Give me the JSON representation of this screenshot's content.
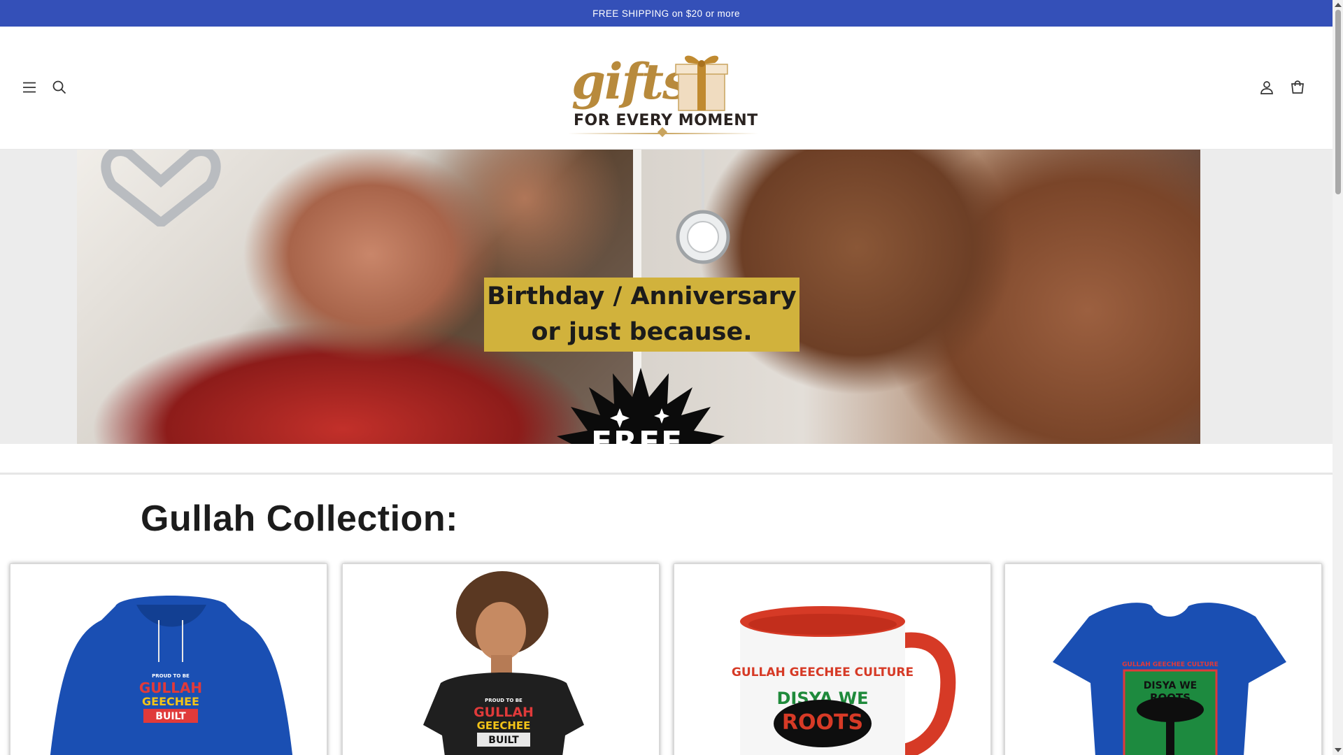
{
  "announcement": {
    "text": "FREE SHIPPING on $20 or more"
  },
  "header": {
    "logo": {
      "word": "gifts",
      "tagline": "FOR EVERY MOMENT"
    },
    "icons": [
      "menu-icon",
      "search-icon",
      "account-icon",
      "cart-icon"
    ]
  },
  "hero": {
    "caption_line1": "Birthday / Anniversary",
    "caption_line2": "or just because.",
    "badge_text": "FREE",
    "caption_color": "#d1b23c"
  },
  "collection": {
    "title": "Gullah Collection:",
    "products": [
      {
        "type": "hoodie",
        "print_lines": [
          "PROUD TO BE",
          "GULLAH",
          "GEECHEE",
          "BUILT"
        ],
        "color": "#1a4fb3"
      },
      {
        "type": "t-shirt",
        "print_lines": [
          "PROUD TO BE",
          "GULLAH",
          "GEECHEE",
          "BUILT"
        ],
        "color": "#1f1f1f"
      },
      {
        "type": "mug",
        "print_lines": [
          "GULLAH GEECHEE CULTURE",
          "DISYA WE",
          "ROOTS"
        ],
        "color": "#d63a26"
      },
      {
        "type": "t-shirt",
        "print_lines": [
          "GULLAH GEECHEE CULTURE",
          "DISYA WE",
          "ROOTS"
        ],
        "color": "#1a4fb3"
      }
    ]
  },
  "colors": {
    "announcement_bg": "#3450b8",
    "logo_gold": "#b88a3c"
  }
}
